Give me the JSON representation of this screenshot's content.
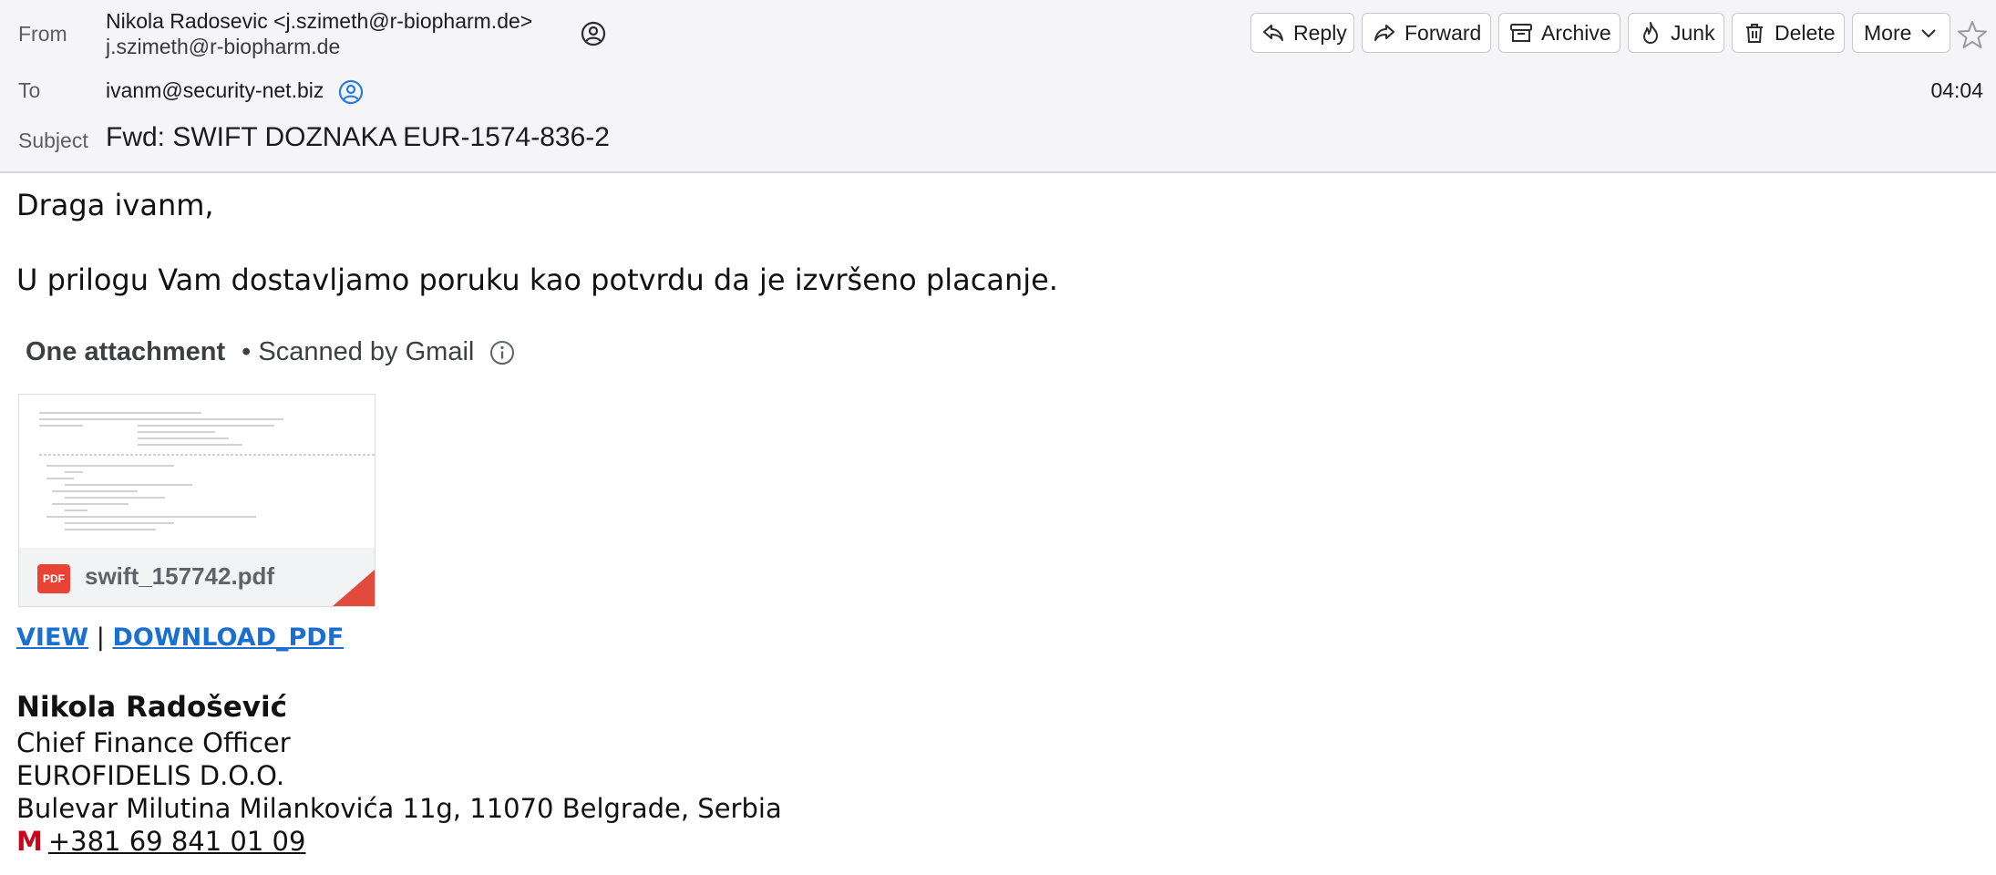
{
  "header": {
    "from_label": "From",
    "from_name": "Nikola Radosevic <j.szimeth@r-biopharm.de>",
    "from_address": "j.szimeth@r-biopharm.de",
    "to_label": "To",
    "to_address": "ivanm@security-net.biz",
    "subject_label": "Subject",
    "subject": "Fwd: SWIFT DOZNAKA EUR-1574-836-2",
    "time": "04:04"
  },
  "toolbar": {
    "reply": "Reply",
    "forward": "Forward",
    "archive": "Archive",
    "junk": "Junk",
    "delete": "Delete",
    "more": "More"
  },
  "body": {
    "greeting": "Draga ivanm,",
    "text": "U prilogu Vam dostavljamo poruku kao potvrdu da je izvršeno placanje."
  },
  "attachment": {
    "title": "One attachment",
    "scanned": "• Scanned by Gmail",
    "badge": "PDF",
    "filename": "swift_157742.pdf"
  },
  "links": {
    "view": "VIEW",
    "separator": "|",
    "download": "DOWNLOAD_PDF"
  },
  "signature": {
    "name": "Nikola Radošević",
    "title": "Chief Finance Officer",
    "company": "EUROFIDELIS D.O.O.",
    "address": "Bulevar Milutina Milankovića 11g, 11070 Belgrade, Serbia",
    "phone_prefix": "M",
    "phone": "+381 69 841 01 09"
  },
  "colors": {
    "link": "#1a6fd0",
    "pdf_red": "#ea4335",
    "mobile_red": "#d0021b",
    "header_bg": "#f5f5f7"
  }
}
